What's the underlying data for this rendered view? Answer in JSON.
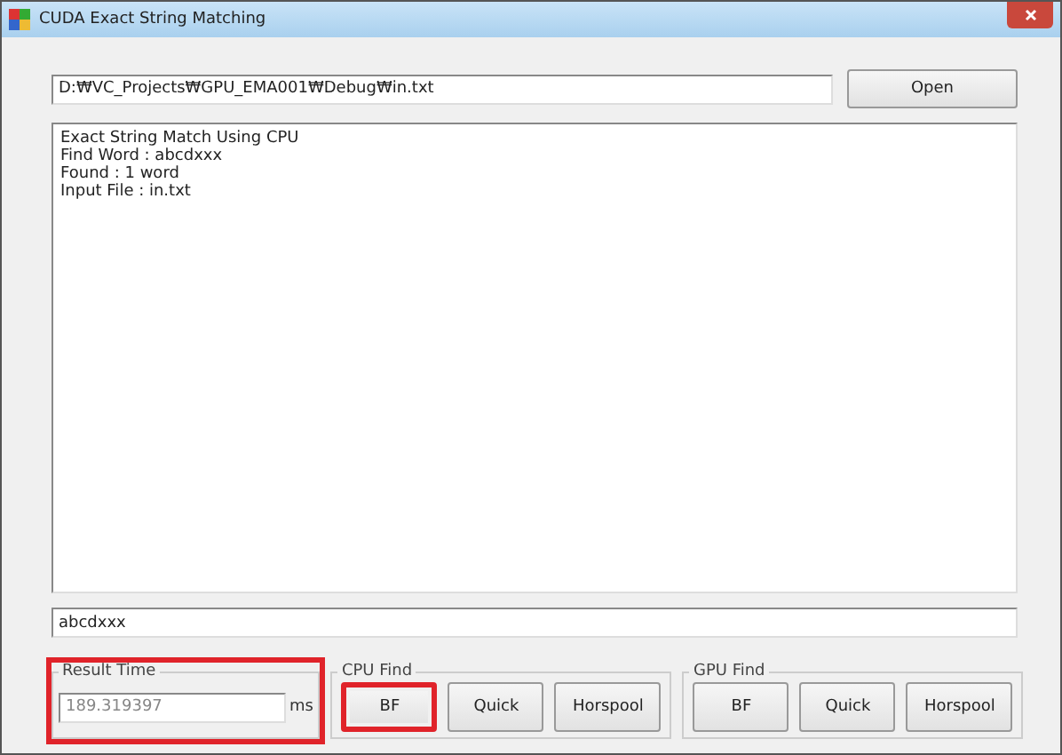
{
  "window": {
    "title": "CUDA Exact String Matching"
  },
  "file_path": {
    "value": "D:₩VC_Projects₩GPU_EMA001₩Debug₩in.txt"
  },
  "open_button": {
    "label": "Open"
  },
  "output": {
    "lines": [
      "Exact String Match Using CPU",
      "Find Word : abcdxxx",
      "Found : 1 word",
      "Input File : in.txt"
    ]
  },
  "search_word": {
    "value": "abcdxxx"
  },
  "result_time": {
    "title": "Result Time",
    "value": "189.319397",
    "unit": "ms",
    "highlighted": true
  },
  "groups": [
    {
      "title": "CPU Find",
      "buttons": [
        {
          "label": "BF",
          "highlighted": true
        },
        {
          "label": "Quick",
          "highlighted": false
        },
        {
          "label": "Horspool",
          "highlighted": false
        }
      ]
    },
    {
      "title": "GPU Find",
      "buttons": [
        {
          "label": "BF",
          "highlighted": false
        },
        {
          "label": "Quick",
          "highlighted": false
        },
        {
          "label": "Horspool",
          "highlighted": false
        }
      ]
    }
  ]
}
